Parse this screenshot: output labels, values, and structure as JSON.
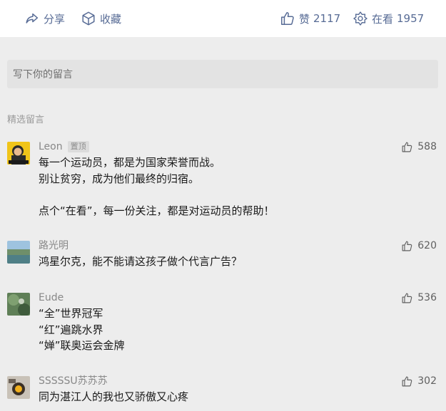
{
  "toolbar": {
    "share_label": "分享",
    "favorite_label": "收藏",
    "like_label": "赞",
    "like_count": "2117",
    "looking_label": "在看",
    "looking_count": "1957",
    "accent_color": "#576b95"
  },
  "comment_input": {
    "placeholder": "写下你的留言"
  },
  "section_title": "精选留言",
  "comments": [
    {
      "name": "Leon",
      "badge": "置顶",
      "likes": "588",
      "text": "每一个运动员，都是为国家荣誉而战。\n别让贫穷，成为他们最终的归宿。\n\n点个“在看”，每一份关注，都是对运动员的帮助！"
    },
    {
      "name": "路光明",
      "likes": "620",
      "text": "鸿星尔克，能不能请这孩子做个代言广告？"
    },
    {
      "name": "Eude",
      "likes": "536",
      "text": "“全”世界冠军\n“红”遍跳水界\n“婵”联奥运会金牌"
    },
    {
      "name": "SSSSSU苏苏苏",
      "likes": "302",
      "text": "同为湛江人的我也又骄傲又心疼"
    }
  ]
}
